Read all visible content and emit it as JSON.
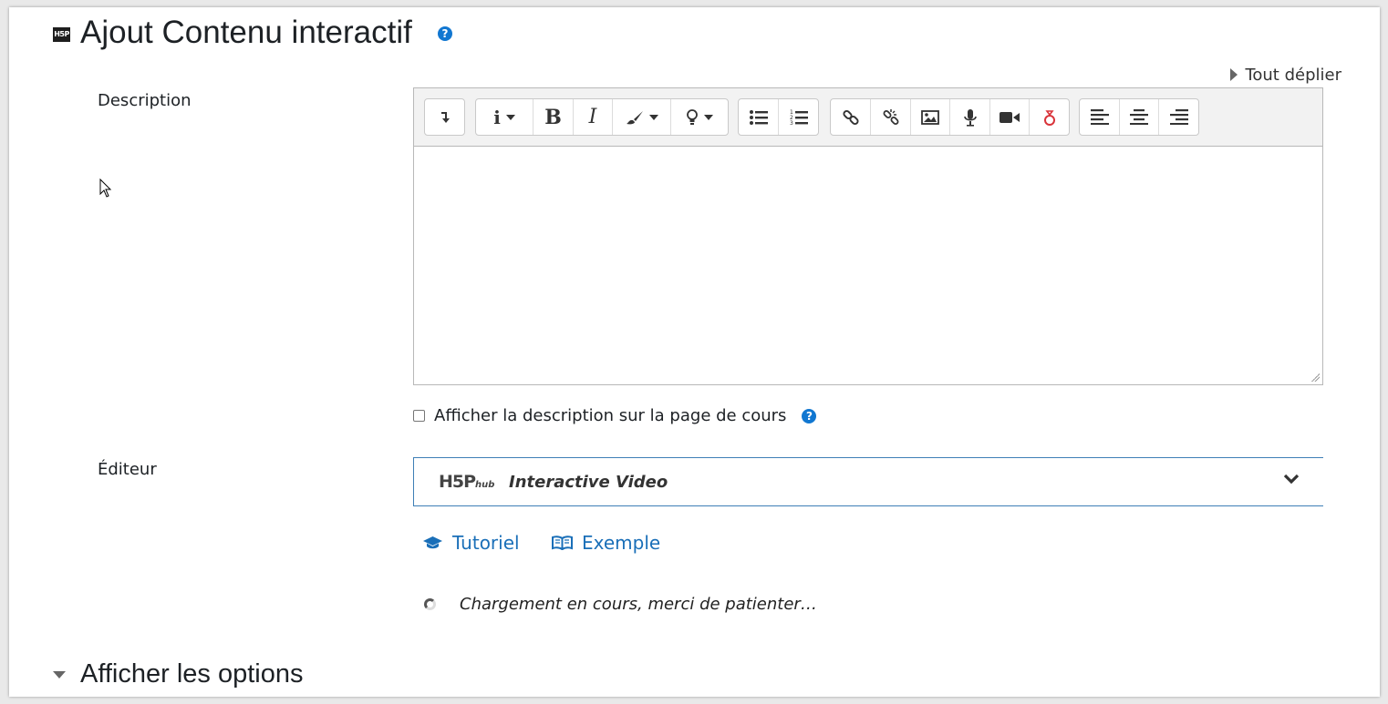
{
  "header": {
    "title": "Ajout Contenu interactif",
    "logo_text": "H5P",
    "help_icon": "question-circle"
  },
  "expand_all": "Tout déplier",
  "description": {
    "label": "Description",
    "content": "",
    "toolbar_icons": [
      "toggle-more-icon",
      "info-icon",
      "bold-icon",
      "italic-icon",
      "paint-brush-icon",
      "lightbulb-icon",
      "bullet-list-icon",
      "numbered-list-icon",
      "link-icon",
      "unlink-icon",
      "image-icon",
      "microphone-icon",
      "video-icon",
      "recordrtc-icon",
      "align-left-icon",
      "align-center-icon",
      "align-right-icon"
    ]
  },
  "show_description": {
    "label": "Afficher la description sur la page de cours",
    "checked": false
  },
  "editor": {
    "label": "Éditeur",
    "hub_logo": "H5P",
    "hub_logo_sub": "hub",
    "content_type": "Interactive Video"
  },
  "links": {
    "tutorial": "Tutoriel",
    "example": "Exemple"
  },
  "loading_text": "Chargement en cours, merci de patienter…",
  "options_section": "Afficher les options",
  "colors": {
    "link": "#1a6fb8",
    "help": "#1177d1",
    "hub_border": "#3e7fb6"
  }
}
